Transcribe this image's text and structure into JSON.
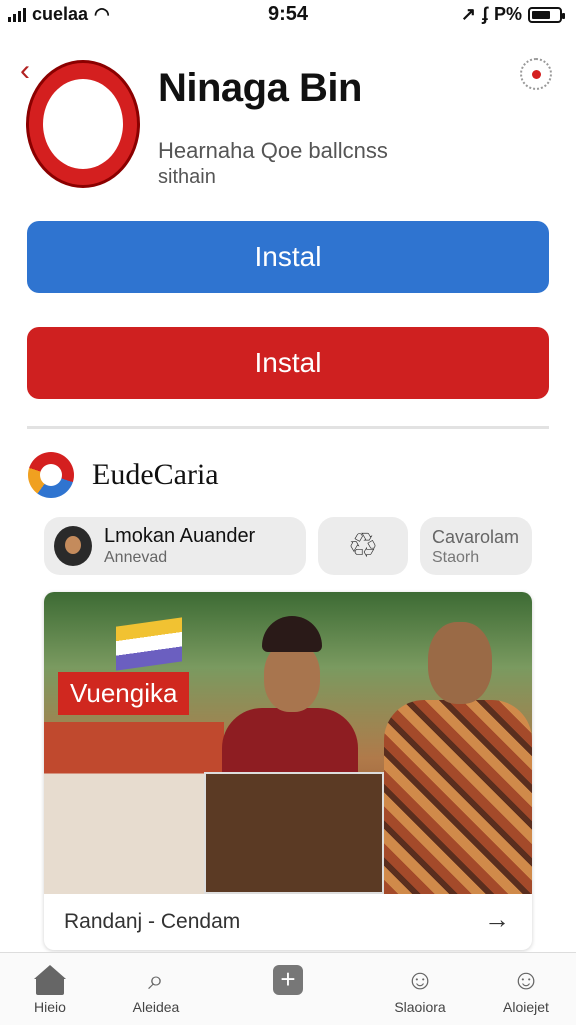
{
  "status_bar": {
    "carrier": "cuelaa",
    "time": "9:54",
    "battery_text": "P%"
  },
  "app": {
    "title": "Ninaga Bin",
    "subtitle_line1": "Hearnaha Qoe ballcnss",
    "subtitle_line2": "sithain"
  },
  "buttons": {
    "primary_label": "Instal",
    "secondary_label": "Instal"
  },
  "section": {
    "title": "EudeCaria"
  },
  "chips": {
    "user_name": "Lmokan Auander",
    "user_role": "Annevad",
    "text_chip_line1": "Cavarolam",
    "text_chip_line2": "Staorh"
  },
  "card": {
    "image_label": "Vuengika",
    "caption": "Randanj - Cendam"
  },
  "tabs": [
    {
      "label": "Hieio",
      "icon": "home-icon"
    },
    {
      "label": "Aleidea",
      "icon": "magnifier-icon"
    },
    {
      "label": "",
      "icon": "add-icon"
    },
    {
      "label": "Slaoiora",
      "icon": "person-icon"
    },
    {
      "label": "Aloiejet",
      "icon": "profile-icon"
    }
  ],
  "colors": {
    "primary_blue": "#2f74d0",
    "primary_red": "#cf2020"
  }
}
